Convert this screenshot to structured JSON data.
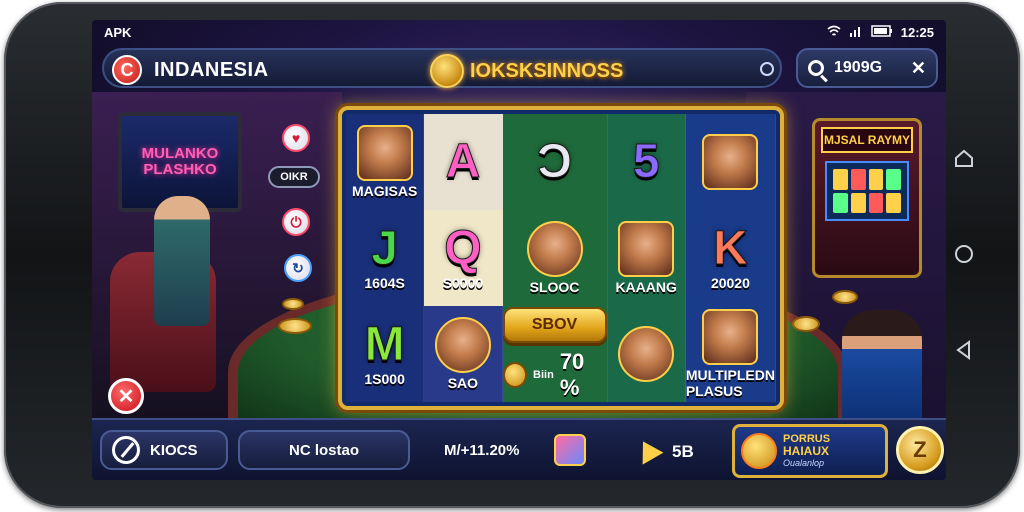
{
  "status_bar": {
    "left_label": "APK",
    "time": "12:25"
  },
  "header": {
    "brand_logo_letter": "C",
    "brand_name": "INDANESIA",
    "center_title": "IOKSKSINNOSS",
    "search_value": "1909G",
    "search_close": "✕"
  },
  "scene": {
    "left_monitor_text": "MULANKO\nPLASHKO",
    "small_label": "OIKR",
    "arcade_sign": "MJSAL RAYMY"
  },
  "slot_grid": {
    "row1": [
      {
        "type": "portrait",
        "caption": "MAGISAS"
      },
      {
        "type": "letter",
        "symbol": "A",
        "color": "#ff5fc5"
      },
      {
        "type": "letter",
        "symbol": "Ɔ",
        "color": "#e8e8f0"
      },
      {
        "type": "letter",
        "symbol": "5",
        "color": "#8a6aff"
      },
      {
        "type": "portrait",
        "caption": ""
      }
    ],
    "row2": [
      {
        "type": "letter",
        "symbol": "J",
        "color": "#4ad84a",
        "caption": "1604S"
      },
      {
        "type": "letter",
        "symbol": "Q",
        "color": "#ff5fc5",
        "caption": "S0000"
      },
      {
        "type": "portrait",
        "caption": "SLOOC"
      },
      {
        "type": "portrait",
        "caption": "KAAANG"
      },
      {
        "type": "letter",
        "symbol": "K",
        "color": "#ff7a5a",
        "caption": "20020"
      }
    ],
    "row3": [
      {
        "type": "letter",
        "symbol": "M",
        "color": "#8ae83a",
        "caption": "1S000"
      },
      {
        "type": "portrait",
        "caption": "SAO"
      },
      {
        "type": "spin",
        "button_label": "SBOV",
        "bonus_small": "Biin",
        "bonus_pct": "70 %"
      },
      {
        "type": "portrait",
        "caption": ""
      },
      {
        "type": "portrait",
        "caption": "MULTIPLEDN PLASUS"
      }
    ]
  },
  "bottom_bar": {
    "left_pill_label": "KIOCS",
    "middle_pill_label": "NC lostao",
    "stat_text": "M/+11.20%",
    "right_value": "5B",
    "promo": {
      "line1": "PORRUS",
      "line2": "HAIAUX",
      "line3": "Oualanlop"
    },
    "coin_symbol": "Z"
  },
  "close_button_symbol": "✕",
  "colors": {
    "accent_gold": "#e0b13a",
    "board_blue": "#102a6a",
    "close_red": "#c8101a"
  }
}
